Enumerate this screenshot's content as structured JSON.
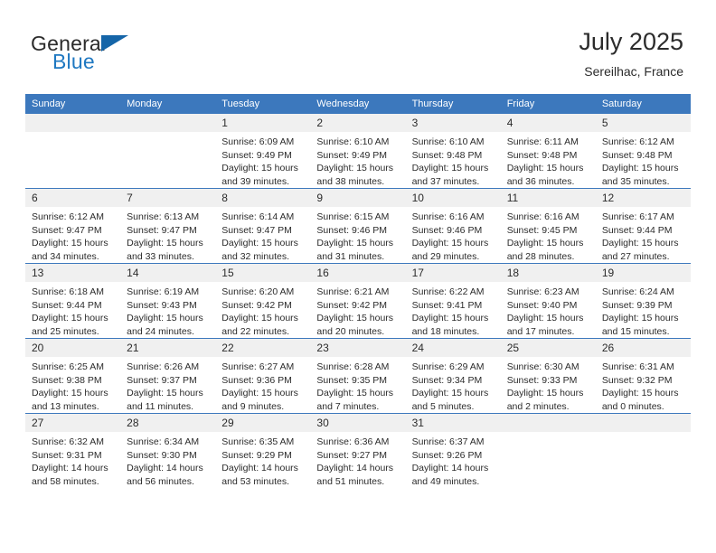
{
  "brand": {
    "name_top": "General",
    "name_bottom": "Blue",
    "flag_icon": "triangle-flag-icon"
  },
  "header": {
    "title": "July 2025",
    "subtitle": "Sereilhac, France"
  },
  "colors": {
    "header_blue": "#3c78bd",
    "brand_blue": "#1f78c1",
    "daynum_bg": "#f0f0f0",
    "text": "#2b2b2b"
  },
  "weekday_headers": [
    "Sunday",
    "Monday",
    "Tuesday",
    "Wednesday",
    "Thursday",
    "Friday",
    "Saturday"
  ],
  "labels": {
    "sunrise_prefix": "Sunrise: ",
    "sunset_prefix": "Sunset: ",
    "daylight_prefix": "Daylight: "
  },
  "weeks": [
    [
      {
        "day": "",
        "sunrise": "",
        "sunset": "",
        "daylight": "",
        "blank": true
      },
      {
        "day": "",
        "sunrise": "",
        "sunset": "",
        "daylight": "",
        "blank": true
      },
      {
        "day": "1",
        "sunrise": "Sunrise: 6:09 AM",
        "sunset": "Sunset: 9:49 PM",
        "daylight": "Daylight: 15 hours and 39 minutes."
      },
      {
        "day": "2",
        "sunrise": "Sunrise: 6:10 AM",
        "sunset": "Sunset: 9:49 PM",
        "daylight": "Daylight: 15 hours and 38 minutes."
      },
      {
        "day": "3",
        "sunrise": "Sunrise: 6:10 AM",
        "sunset": "Sunset: 9:48 PM",
        "daylight": "Daylight: 15 hours and 37 minutes."
      },
      {
        "day": "4",
        "sunrise": "Sunrise: 6:11 AM",
        "sunset": "Sunset: 9:48 PM",
        "daylight": "Daylight: 15 hours and 36 minutes."
      },
      {
        "day": "5",
        "sunrise": "Sunrise: 6:12 AM",
        "sunset": "Sunset: 9:48 PM",
        "daylight": "Daylight: 15 hours and 35 minutes."
      }
    ],
    [
      {
        "day": "6",
        "sunrise": "Sunrise: 6:12 AM",
        "sunset": "Sunset: 9:47 PM",
        "daylight": "Daylight: 15 hours and 34 minutes."
      },
      {
        "day": "7",
        "sunrise": "Sunrise: 6:13 AM",
        "sunset": "Sunset: 9:47 PM",
        "daylight": "Daylight: 15 hours and 33 minutes."
      },
      {
        "day": "8",
        "sunrise": "Sunrise: 6:14 AM",
        "sunset": "Sunset: 9:47 PM",
        "daylight": "Daylight: 15 hours and 32 minutes."
      },
      {
        "day": "9",
        "sunrise": "Sunrise: 6:15 AM",
        "sunset": "Sunset: 9:46 PM",
        "daylight": "Daylight: 15 hours and 31 minutes."
      },
      {
        "day": "10",
        "sunrise": "Sunrise: 6:16 AM",
        "sunset": "Sunset: 9:46 PM",
        "daylight": "Daylight: 15 hours and 29 minutes."
      },
      {
        "day": "11",
        "sunrise": "Sunrise: 6:16 AM",
        "sunset": "Sunset: 9:45 PM",
        "daylight": "Daylight: 15 hours and 28 minutes."
      },
      {
        "day": "12",
        "sunrise": "Sunrise: 6:17 AM",
        "sunset": "Sunset: 9:44 PM",
        "daylight": "Daylight: 15 hours and 27 minutes."
      }
    ],
    [
      {
        "day": "13",
        "sunrise": "Sunrise: 6:18 AM",
        "sunset": "Sunset: 9:44 PM",
        "daylight": "Daylight: 15 hours and 25 minutes."
      },
      {
        "day": "14",
        "sunrise": "Sunrise: 6:19 AM",
        "sunset": "Sunset: 9:43 PM",
        "daylight": "Daylight: 15 hours and 24 minutes."
      },
      {
        "day": "15",
        "sunrise": "Sunrise: 6:20 AM",
        "sunset": "Sunset: 9:42 PM",
        "daylight": "Daylight: 15 hours and 22 minutes."
      },
      {
        "day": "16",
        "sunrise": "Sunrise: 6:21 AM",
        "sunset": "Sunset: 9:42 PM",
        "daylight": "Daylight: 15 hours and 20 minutes."
      },
      {
        "day": "17",
        "sunrise": "Sunrise: 6:22 AM",
        "sunset": "Sunset: 9:41 PM",
        "daylight": "Daylight: 15 hours and 18 minutes."
      },
      {
        "day": "18",
        "sunrise": "Sunrise: 6:23 AM",
        "sunset": "Sunset: 9:40 PM",
        "daylight": "Daylight: 15 hours and 17 minutes."
      },
      {
        "day": "19",
        "sunrise": "Sunrise: 6:24 AM",
        "sunset": "Sunset: 9:39 PM",
        "daylight": "Daylight: 15 hours and 15 minutes."
      }
    ],
    [
      {
        "day": "20",
        "sunrise": "Sunrise: 6:25 AM",
        "sunset": "Sunset: 9:38 PM",
        "daylight": "Daylight: 15 hours and 13 minutes."
      },
      {
        "day": "21",
        "sunrise": "Sunrise: 6:26 AM",
        "sunset": "Sunset: 9:37 PM",
        "daylight": "Daylight: 15 hours and 11 minutes."
      },
      {
        "day": "22",
        "sunrise": "Sunrise: 6:27 AM",
        "sunset": "Sunset: 9:36 PM",
        "daylight": "Daylight: 15 hours and 9 minutes."
      },
      {
        "day": "23",
        "sunrise": "Sunrise: 6:28 AM",
        "sunset": "Sunset: 9:35 PM",
        "daylight": "Daylight: 15 hours and 7 minutes."
      },
      {
        "day": "24",
        "sunrise": "Sunrise: 6:29 AM",
        "sunset": "Sunset: 9:34 PM",
        "daylight": "Daylight: 15 hours and 5 minutes."
      },
      {
        "day": "25",
        "sunrise": "Sunrise: 6:30 AM",
        "sunset": "Sunset: 9:33 PM",
        "daylight": "Daylight: 15 hours and 2 minutes."
      },
      {
        "day": "26",
        "sunrise": "Sunrise: 6:31 AM",
        "sunset": "Sunset: 9:32 PM",
        "daylight": "Daylight: 15 hours and 0 minutes."
      }
    ],
    [
      {
        "day": "27",
        "sunrise": "Sunrise: 6:32 AM",
        "sunset": "Sunset: 9:31 PM",
        "daylight": "Daylight: 14 hours and 58 minutes."
      },
      {
        "day": "28",
        "sunrise": "Sunrise: 6:34 AM",
        "sunset": "Sunset: 9:30 PM",
        "daylight": "Daylight: 14 hours and 56 minutes."
      },
      {
        "day": "29",
        "sunrise": "Sunrise: 6:35 AM",
        "sunset": "Sunset: 9:29 PM",
        "daylight": "Daylight: 14 hours and 53 minutes."
      },
      {
        "day": "30",
        "sunrise": "Sunrise: 6:36 AM",
        "sunset": "Sunset: 9:27 PM",
        "daylight": "Daylight: 14 hours and 51 minutes."
      },
      {
        "day": "31",
        "sunrise": "Sunrise: 6:37 AM",
        "sunset": "Sunset: 9:26 PM",
        "daylight": "Daylight: 14 hours and 49 minutes."
      },
      {
        "day": "",
        "sunrise": "",
        "sunset": "",
        "daylight": "",
        "blank": true
      },
      {
        "day": "",
        "sunrise": "",
        "sunset": "",
        "daylight": "",
        "blank": true
      }
    ]
  ]
}
